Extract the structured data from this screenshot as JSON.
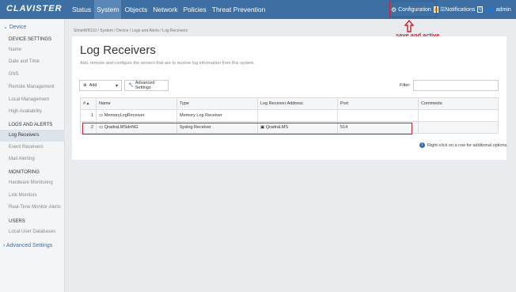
{
  "brand": "CLAVISTER",
  "nav": [
    "Status",
    "System",
    "Objects",
    "Network",
    "Policies",
    "Threat Prevention"
  ],
  "topbar": {
    "configuration": "Configuration",
    "notifications": "Notifications",
    "notifications_count": "0",
    "user": "admin"
  },
  "annotation": "save and active seçeneginden aktif edelim",
  "sidebar": {
    "device": "Device",
    "device_settings": "DEVICE SETTINGS",
    "device_items": [
      "Name",
      "Date and Time",
      "DNS",
      "Remote Management",
      "Local Management",
      "High Availability"
    ],
    "logs_section": "LOGS AND ALERTS",
    "logs_items": [
      "Log Receivers",
      "Event Receivers",
      "Mail Alerting"
    ],
    "monitoring_section": "MONITORING",
    "monitoring_items": [
      "Hardware Monitoring",
      "Link Monitors",
      "Real-Time Monitor Alerts"
    ],
    "users_section": "USERS",
    "users_items": [
      "Local User Databases"
    ],
    "advanced": "Advanced Settings"
  },
  "breadcrumb": "SimetWR110 / System / Device / Logs and Alerts / Log Receivers",
  "page": {
    "title": "Log Receivers",
    "subtitle": "Add, remove and configure the servers that are to receive log information from this system."
  },
  "toolbar": {
    "add": "Add",
    "advanced": "Advanced Settings",
    "filter": "Filter:"
  },
  "table": {
    "headers": [
      "#",
      "Name",
      "Type",
      "Log Receiver Address",
      "Port",
      "Comments"
    ],
    "rows": [
      {
        "num": "1",
        "name": "MemoryLogReceiver",
        "type": "Memory Log Receiver",
        "address": "",
        "port": "",
        "comments": ""
      },
      {
        "num": "2",
        "name": "QradraLMSdnNG",
        "type": "Syslog Receiver",
        "address": "QradraLMS",
        "port": "514",
        "comments": ""
      }
    ]
  },
  "hint": "Right-click on a row for additional options.",
  "colors": {
    "topbar": "#3d6fa3",
    "highlight": "#d0202a",
    "accent_badge": "#e8b13d"
  }
}
